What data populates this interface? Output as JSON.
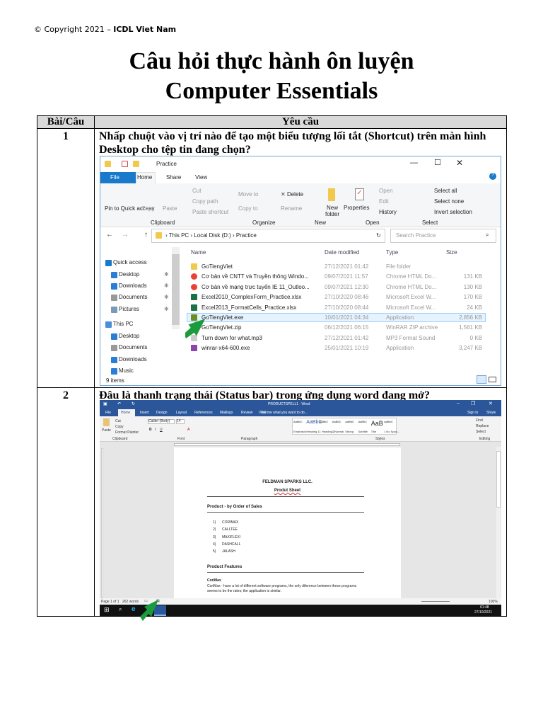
{
  "header": {
    "copyright_prefix": "© Copyright 2021 – ",
    "copyright_org": "ICDL Viet Nam"
  },
  "title": {
    "line1": "Câu hỏi thực hành ôn luyện",
    "line2": "Computer Essentials"
  },
  "table": {
    "headers": [
      "Bài/Câu",
      "Yêu cầu"
    ],
    "rows": [
      {
        "num": "1",
        "question": "Nhấp chuột vào vị trí nào để tạo một biểu tượng lối tắt (Shortcut) trên màn hình Desktop cho tệp tin đang chọn?"
      },
      {
        "num": "2",
        "question": "Đâu là thanh trạng thái (Status bar) trong ứng dụng word đang mở?"
      }
    ]
  },
  "explorer": {
    "window_title": "Practice",
    "tabs": [
      "File",
      "Home",
      "Share",
      "View"
    ],
    "ribbon": {
      "clipboard": {
        "label": "Clipboard",
        "pin": "Pin to Quick access",
        "copy": "Copy",
        "paste": "Paste",
        "cut": "Cut",
        "copy_path": "Copy path",
        "paste_shortcut": "Paste shortcut"
      },
      "organize": {
        "label": "Organize",
        "move_to": "Move to",
        "copy_to": "Copy to",
        "delete": "Delete",
        "rename": "Rename"
      },
      "new": {
        "label": "New",
        "new_folder": "New folder"
      },
      "open": {
        "label": "Open",
        "properties": "Properties",
        "open": "Open",
        "edit": "Edit",
        "history": "History"
      },
      "select": {
        "label": "Select",
        "select_all": "Select all",
        "select_none": "Select none",
        "invert": "Invert selection"
      }
    },
    "breadcrumb": [
      "This PC",
      "Local Disk (D:)",
      "Practice"
    ],
    "search_placeholder": "Search Practice",
    "nav": [
      "Quick access",
      "Desktop",
      "Downloads",
      "Documents",
      "Pictures",
      "This PC",
      "Desktop",
      "Documents",
      "Downloads",
      "Music"
    ],
    "columns": [
      "Name",
      "Date modified",
      "Type",
      "Size"
    ],
    "files": [
      {
        "name": "GoTiengViet",
        "date": "27/12/2021 01:42",
        "type": "File folder",
        "size": "",
        "icon": "folder"
      },
      {
        "name": "Cơ bản về CNTT và Truyền thông Windo...",
        "date": "09/07/2021 11:57",
        "type": "Chrome HTML Do...",
        "size": "131 KB",
        "icon": "chrome"
      },
      {
        "name": "Cơ bản về mạng trực tuyến IE 11_Outloo...",
        "date": "09/07/2021 12:30",
        "type": "Chrome HTML Do...",
        "size": "130 KB",
        "icon": "chrome"
      },
      {
        "name": "Excel2010_ComplexForm_Practice.xlsx",
        "date": "27/10/2020 08:46",
        "type": "Microsoft Excel W...",
        "size": "170 KB",
        "icon": "excel"
      },
      {
        "name": "Excel2013_FormatCells_Practice.xlsx",
        "date": "27/10/2020 08:44",
        "type": "Microsoft Excel W...",
        "size": "24 KB",
        "icon": "excel"
      },
      {
        "name": "GoTiengViet.exe",
        "date": "10/01/2021 04:34",
        "type": "Application",
        "size": "2,856 KB",
        "icon": "gotiengviet",
        "selected": true
      },
      {
        "name": "GoTiengViet.zip",
        "date": "06/12/2021 06:15",
        "type": "WinRAR ZIP archive",
        "size": "1,561 KB",
        "icon": "winrar"
      },
      {
        "name": "Turn down for what.mp3",
        "date": "27/12/2021 01:42",
        "type": "MP3 Format Sound",
        "size": "0 KB",
        "icon": "audio"
      },
      {
        "name": "winrar-x64-600.exe",
        "date": "25/01/2021 10:19",
        "type": "Application",
        "size": "3,247 KB",
        "icon": "winrar"
      }
    ],
    "status": "9 items"
  },
  "word": {
    "window_title": "PRODUCTSPELL1 - Word",
    "tabs": [
      "File",
      "Home",
      "Insert",
      "Design",
      "Layout",
      "References",
      "Mailings",
      "Review",
      "View"
    ],
    "tell_me": "Tell me what you want to do...",
    "sign_in": "Sign in",
    "share": "Share",
    "clipboard": {
      "paste": "Paste",
      "cut": "Cut",
      "copy": "Copy",
      "format_painter": "Format Painter",
      "label": "Clipboard"
    },
    "font": {
      "name": "Calibri (Body)",
      "size": "14",
      "label": "Font"
    },
    "paragraph_label": "Paragraph",
    "styles": [
      "Emphasis",
      "Heading 1",
      "1 Heading 2",
      "1 Normal",
      "Strong",
      "Subtitle",
      "Title",
      "1 No Spac..."
    ],
    "styles_label": "Styles",
    "editing": {
      "find": "Find",
      "replace": "Replace",
      "select": "Select",
      "label": "Editing"
    },
    "document": {
      "company": "FELDMAN SPARKS LLC.",
      "subtitle": "Produt Sheet",
      "section1": "Product - by Order of Sales",
      "list": [
        "CORIMAX",
        "CALLTEE",
        "MAXIFLEXI",
        "DASHCALL",
        "JALASH"
      ],
      "section2": "Product Features",
      "feature_title": "CoriMax",
      "feature_text": "CoriMax - have a lot of different software programs, the only diference between these programs seems to be the rates; the application is similar."
    },
    "status": {
      "page": "Page 1 of 1",
      "words": "262 words",
      "zoom": "100%"
    },
    "taskbar": {
      "time": "01:48",
      "date": "27/10/2021"
    }
  },
  "colors": {
    "explorer_file_tab": "#1979ca",
    "word_blue": "#2b579a",
    "arrow_green": "#1a9b3c",
    "table_header_bg": "#d9d9d9"
  }
}
